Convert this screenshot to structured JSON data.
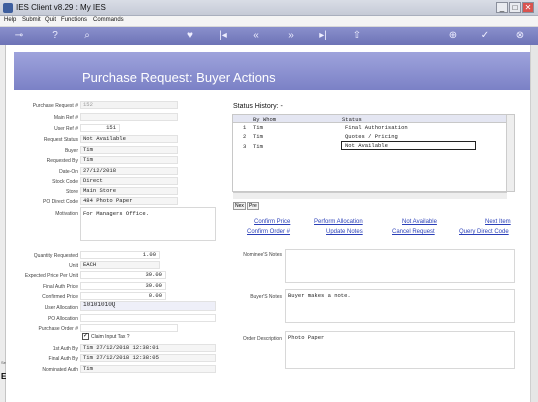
{
  "window": {
    "title": "IES Client v8.29 : My IES",
    "min": "_",
    "max": "□",
    "close": "✕"
  },
  "menu": [
    "Help",
    "Submit",
    "Quit",
    "Functions",
    "Commands"
  ],
  "page_title": "Purchase Request: Buyer Actions",
  "form": {
    "purchase_request_label": "Purchase Request #",
    "purchase_request_value": "152",
    "main_ref_label": "Main Ref #",
    "main_ref_value": "",
    "user_ref_label": "User Ref #",
    "user_ref_value": "151",
    "request_status_label": "Request Status",
    "request_status_value": "Not Available",
    "buyer_label": "Buyer",
    "buyer_value": "Tim",
    "requested_by_label": "Requested By",
    "requested_by_value": "Tim",
    "date_on_label": "Date-On",
    "date_on_value": "27/12/2018",
    "stock_code_label": "Stock Code",
    "stock_code_value": "Direct",
    "store_label": "Store",
    "store_value": "Main Store",
    "po_direct_code_label": "PO Direct Code",
    "po_direct_code_value": "484 Photo Paper",
    "motivation_label": "Motivation",
    "motivation_value": "For Managers Office.",
    "qty_label": "Quantity Requested",
    "qty_value": "1.00",
    "unit_label": "Unit",
    "unit_value": "EACH",
    "expected_price_label": "Expected Price Per Unit",
    "expected_price_value": "39.00",
    "final_auth_price_label": "Final Auth Price",
    "final_auth_price_value": "39.00",
    "confirmed_price_label": "Confirmed Price",
    "confirmed_price_value": "0.00",
    "user_allocation_label": "User Allocation",
    "user_allocation_value": "10101010Q",
    "po_allocation_label": "PO Allocation",
    "po_allocation_value": "",
    "purchase_order_label": "Purchase Order #",
    "purchase_order_value": "",
    "claim_input_tax_label": "Claim Input Tax ?",
    "first_auth_label": "1st Auth By",
    "first_auth_value": "Tim 27/12/2018 12:38:01",
    "final_auth_label": "Final Auth By",
    "final_auth_value": "Tim 27/12/2018 12:38:05",
    "nominated_auth_label": "Nominated Auth",
    "nominated_auth_value": "Tim"
  },
  "status_history": {
    "title": "Status History: -",
    "col_who": "By Whom",
    "col_status": "Status",
    "rows": [
      {
        "n": "1",
        "who": "Tim",
        "status": "Final Authorisation"
      },
      {
        "n": "2",
        "who": "Tim",
        "status": "Quotes / Pricing"
      },
      {
        "n": "3",
        "who": "Tim",
        "status": "Not Available"
      }
    ],
    "nav_next": "Nex",
    "nav_prev": "Pre"
  },
  "actions": {
    "confirm_price": "Confirm Price",
    "perform_allocation": "Perform Allocation",
    "not_available": "Not Available",
    "next_item": "Next Item",
    "confirm_order": "Confirm Order #",
    "update_notes": "Update Notes",
    "cancel_request": "Cancel Request",
    "query_direct_code": "Query Direct Code"
  },
  "notes": {
    "nominee_label": "Nominee'S Notes",
    "nominee_value": "",
    "buyer_label": "Buyer'S Notes",
    "buyer_value": "Buyer makes a note.",
    "order_desc_label": "Order Description",
    "order_desc_value": "Photo Paper"
  },
  "side": {
    "sec": "Sec",
    "e": "E"
  }
}
